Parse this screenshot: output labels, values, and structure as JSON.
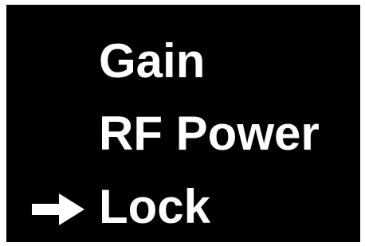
{
  "menu": {
    "items": [
      {
        "label": "Gain"
      },
      {
        "label": "RF Power"
      },
      {
        "label": "Lock"
      }
    ],
    "selected": "Lock",
    "cursor_icon": "right-arrow-icon"
  },
  "colors": {
    "background": "#000000",
    "text": "#ffffff",
    "frame": "#ffffff"
  }
}
